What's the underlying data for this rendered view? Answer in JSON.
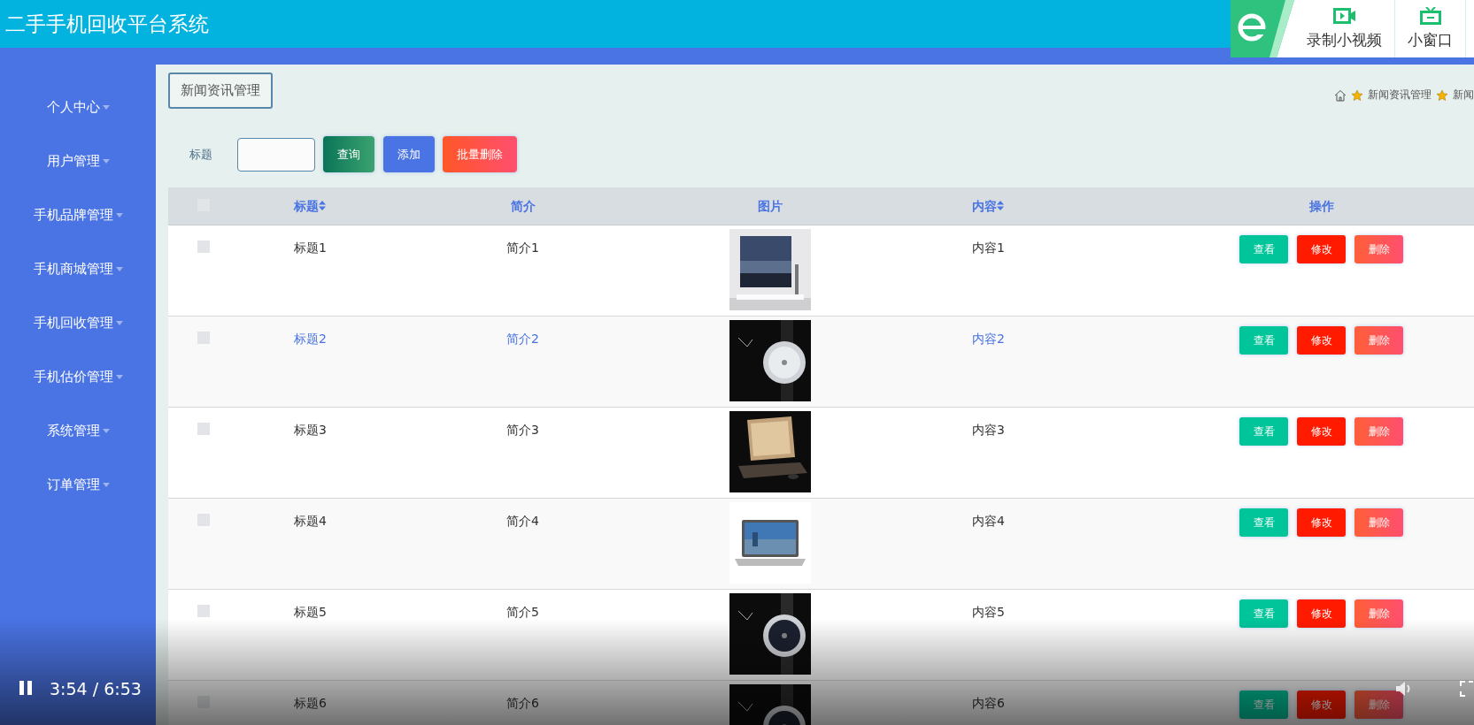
{
  "app": {
    "title": "二手手机回收平台系统"
  },
  "recorder": {
    "buttons": [
      {
        "label": "录制小视频",
        "kind": "record"
      },
      {
        "label": "小窗口",
        "kind": "window"
      }
    ]
  },
  "sidebar": {
    "items": [
      {
        "label": "个人中心"
      },
      {
        "label": "用户管理"
      },
      {
        "label": "手机品牌管理"
      },
      {
        "label": "手机商城管理"
      },
      {
        "label": "手机回收管理"
      },
      {
        "label": "手机估价管理"
      },
      {
        "label": "系统管理"
      },
      {
        "label": "订单管理"
      }
    ]
  },
  "page_tab": "新闻资讯管理",
  "breadcrumb": [
    "新闻资讯管理",
    "新闻"
  ],
  "search": {
    "label": "标题",
    "buttons": [
      {
        "label": "查询",
        "kind": "search"
      },
      {
        "label": "添加",
        "kind": "add"
      },
      {
        "label": "批量删除",
        "kind": "delete"
      }
    ]
  },
  "table": {
    "select_all": {
      "checked": false
    },
    "columns": [
      {
        "label": "标题",
        "sortable": true
      },
      {
        "label": "简介",
        "sortable": false
      },
      {
        "label": "图片",
        "sortable": false
      },
      {
        "label": "内容",
        "sortable": true
      },
      {
        "label": "操作",
        "sortable": false
      }
    ],
    "rows": [
      {
        "checked": false,
        "hovered": false,
        "title": "标题1",
        "intro": "简介1",
        "content": "内容1",
        "actions": [
          {
            "label": "查看",
            "kind": "view"
          },
          {
            "label": "修改",
            "kind": "edit"
          },
          {
            "label": "删除",
            "kind": "delete"
          }
        ]
      },
      {
        "checked": false,
        "hovered": true,
        "title": "标题2",
        "intro": "简介2",
        "content": "内容2",
        "actions": [
          {
            "label": "查看",
            "kind": "view"
          },
          {
            "label": "修改",
            "kind": "edit"
          },
          {
            "label": "删除",
            "kind": "delete"
          }
        ]
      },
      {
        "checked": false,
        "hovered": false,
        "title": "标题3",
        "intro": "简介3",
        "content": "内容3",
        "actions": [
          {
            "label": "查看",
            "kind": "view"
          },
          {
            "label": "修改",
            "kind": "edit"
          },
          {
            "label": "删除",
            "kind": "delete"
          }
        ]
      },
      {
        "checked": false,
        "hovered": false,
        "title": "标题4",
        "intro": "简介4",
        "content": "内容4",
        "actions": [
          {
            "label": "查看",
            "kind": "view"
          },
          {
            "label": "修改",
            "kind": "edit"
          },
          {
            "label": "删除",
            "kind": "delete"
          }
        ]
      },
      {
        "checked": false,
        "hovered": false,
        "title": "标题5",
        "intro": "简介5",
        "content": "内容5",
        "actions": [
          {
            "label": "查看",
            "kind": "view"
          },
          {
            "label": "修改",
            "kind": "edit"
          },
          {
            "label": "删除",
            "kind": "delete"
          }
        ]
      },
      {
        "checked": false,
        "hovered": false,
        "title": "标题6",
        "intro": "简介6",
        "content": "内容6",
        "actions": [
          {
            "label": "查看",
            "kind": "view"
          },
          {
            "label": "修改",
            "kind": "edit"
          },
          {
            "label": "删除",
            "kind": "delete"
          }
        ]
      }
    ]
  },
  "player": {
    "playing": true,
    "time": "3:54 / 6:53"
  }
}
